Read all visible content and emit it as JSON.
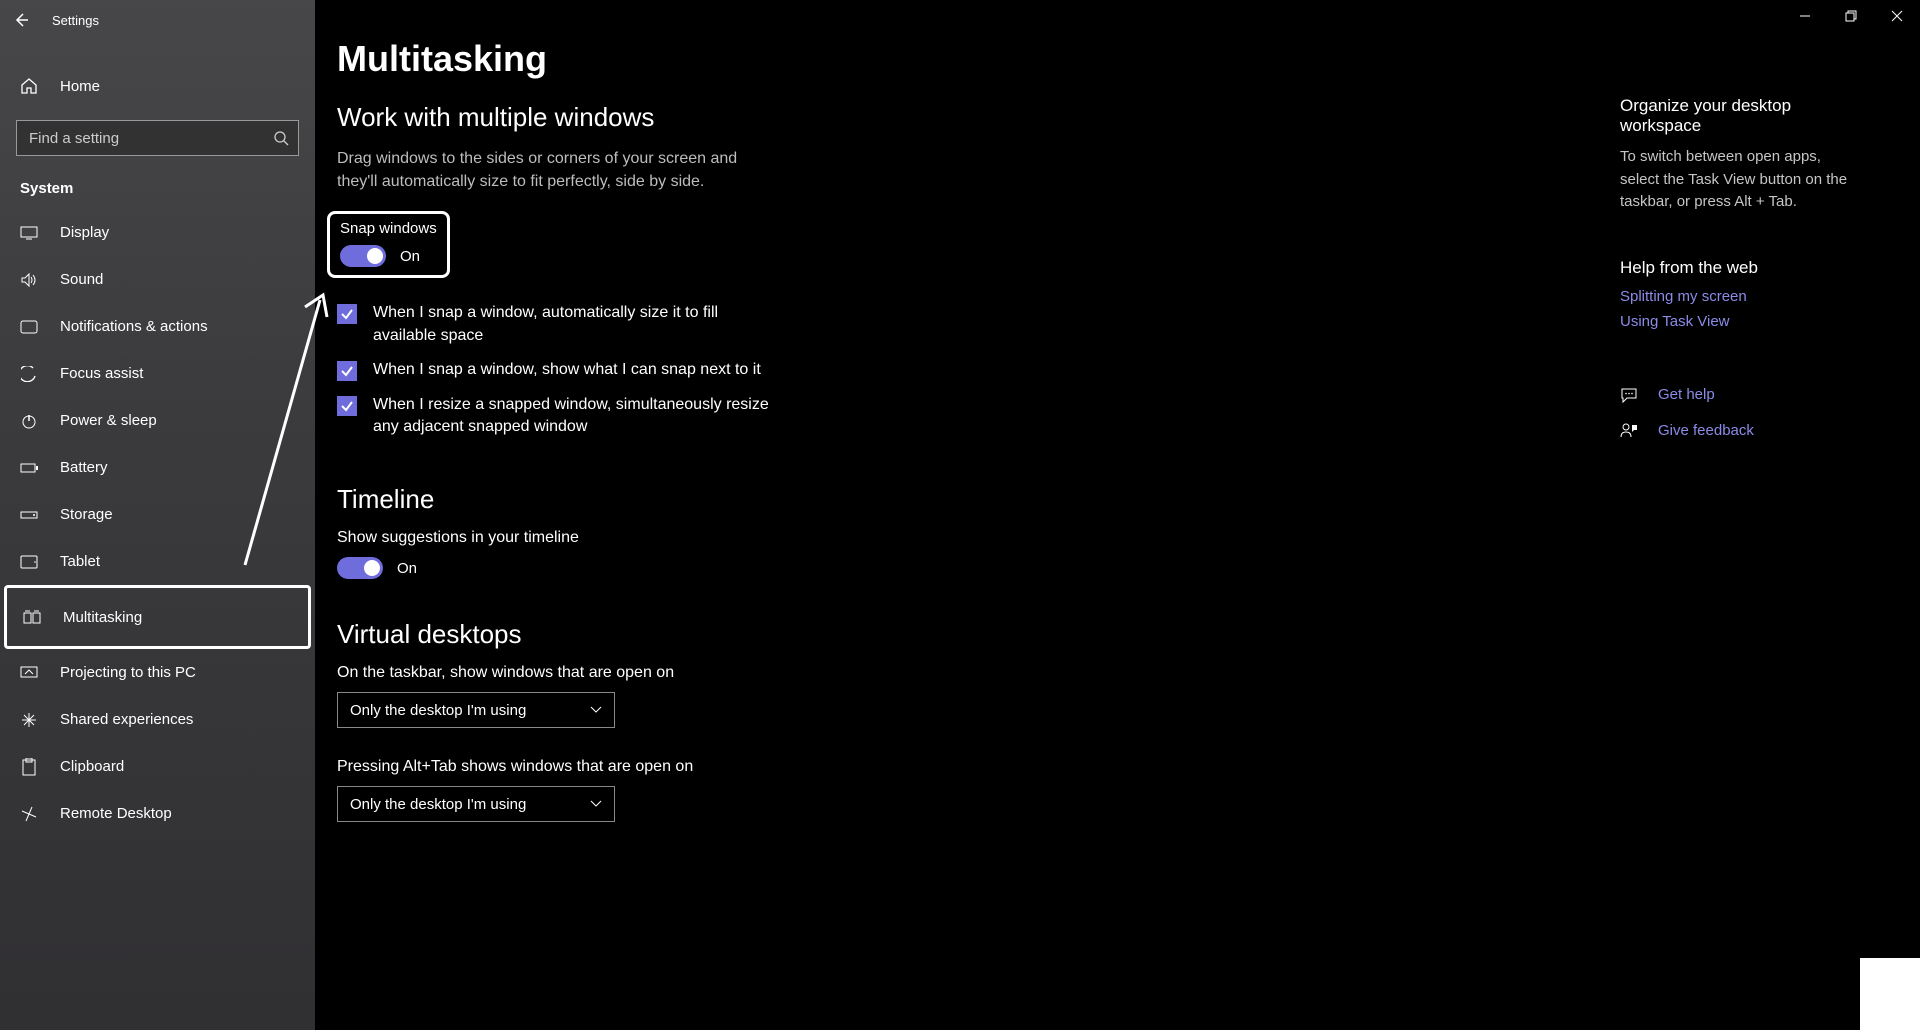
{
  "app": {
    "title": "Settings"
  },
  "sidebar": {
    "home": "Home",
    "search_placeholder": "Find a setting",
    "category": "System",
    "items": [
      {
        "label": "Display"
      },
      {
        "label": "Sound"
      },
      {
        "label": "Notifications & actions"
      },
      {
        "label": "Focus assist"
      },
      {
        "label": "Power & sleep"
      },
      {
        "label": "Battery"
      },
      {
        "label": "Storage"
      },
      {
        "label": "Tablet"
      },
      {
        "label": "Multitasking"
      },
      {
        "label": "Projecting to this PC"
      },
      {
        "label": "Shared experiences"
      },
      {
        "label": "Clipboard"
      },
      {
        "label": "Remote Desktop"
      }
    ]
  },
  "main": {
    "title": "Multitasking",
    "snap": {
      "heading": "Work with multiple windows",
      "desc": "Drag windows to the sides or corners of your screen and they'll automatically size to fit perfectly, side by side.",
      "toggle_label": "Snap windows",
      "toggle_state": "On",
      "checks": [
        "When I snap a window, automatically size it to fill available space",
        "When I snap a window, show what I can snap next to it",
        "When I resize a snapped window, simultaneously resize any adjacent snapped window"
      ]
    },
    "timeline": {
      "heading": "Timeline",
      "label": "Show suggestions in your timeline",
      "toggle_state": "On"
    },
    "virtual": {
      "heading": "Virtual desktops",
      "taskbar_label": "On the taskbar, show windows that are open on",
      "taskbar_value": "Only the desktop I'm using",
      "alttab_label": "Pressing Alt+Tab shows windows that are open on",
      "alttab_value": "Only the desktop I'm using"
    }
  },
  "aside": {
    "heading1": "Organize your desktop workspace",
    "text1": "To switch between open apps, select the Task View button on the taskbar, or press Alt + Tab.",
    "heading2": "Help from the web",
    "link1": "Splitting my screen",
    "link2": "Using Task View",
    "get_help": "Get help",
    "give_feedback": "Give feedback"
  }
}
